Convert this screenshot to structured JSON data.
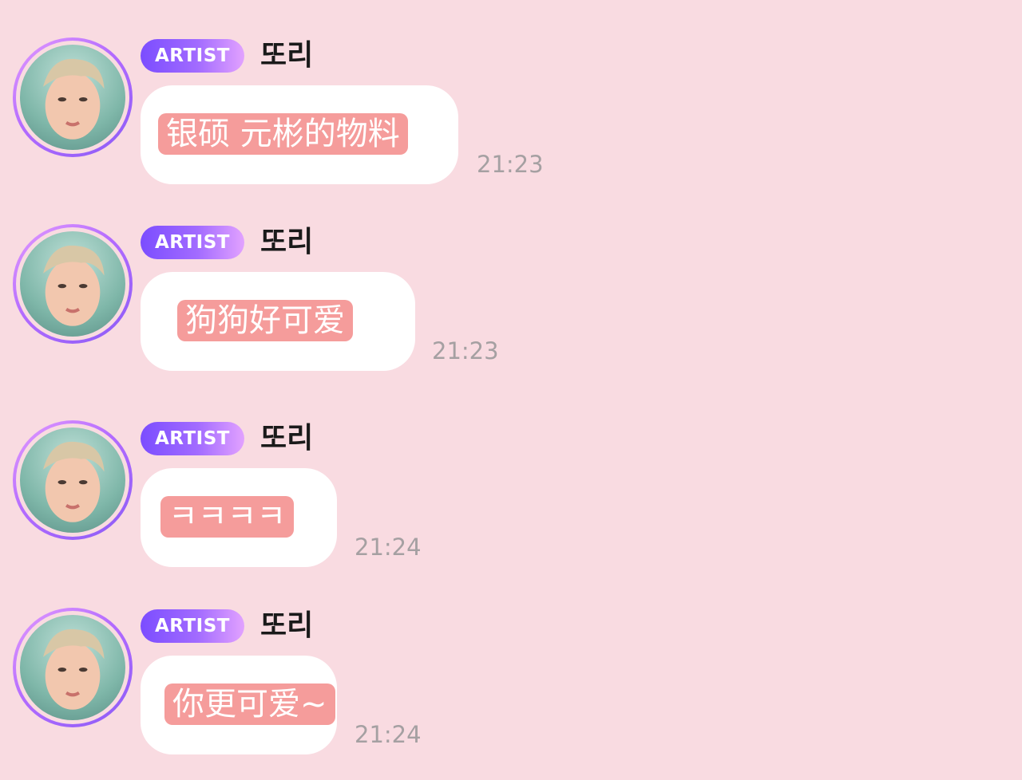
{
  "messages": [
    {
      "badge": "ARTIST",
      "sender": "또리",
      "text": "银硕 元彬的物料",
      "time": "21:23"
    },
    {
      "badge": "ARTIST",
      "sender": "또리",
      "text": "狗狗好可爱",
      "time": "21:23"
    },
    {
      "badge": "ARTIST",
      "sender": "또리",
      "text": "ㅋㅋㅋㅋ",
      "time": "21:24"
    },
    {
      "badge": "ARTIST",
      "sender": "또리",
      "text": "你更可爱~",
      "time": "21:24"
    }
  ],
  "colors": {
    "background": "#f9dbe1",
    "bubble": "#ffffff",
    "highlight": "#f59c9b",
    "badge_start": "#7b4dff",
    "badge_end": "#e2a2ff",
    "timestamp": "#a5a0a2"
  },
  "icons": {
    "avatar": "avatar-photo"
  }
}
